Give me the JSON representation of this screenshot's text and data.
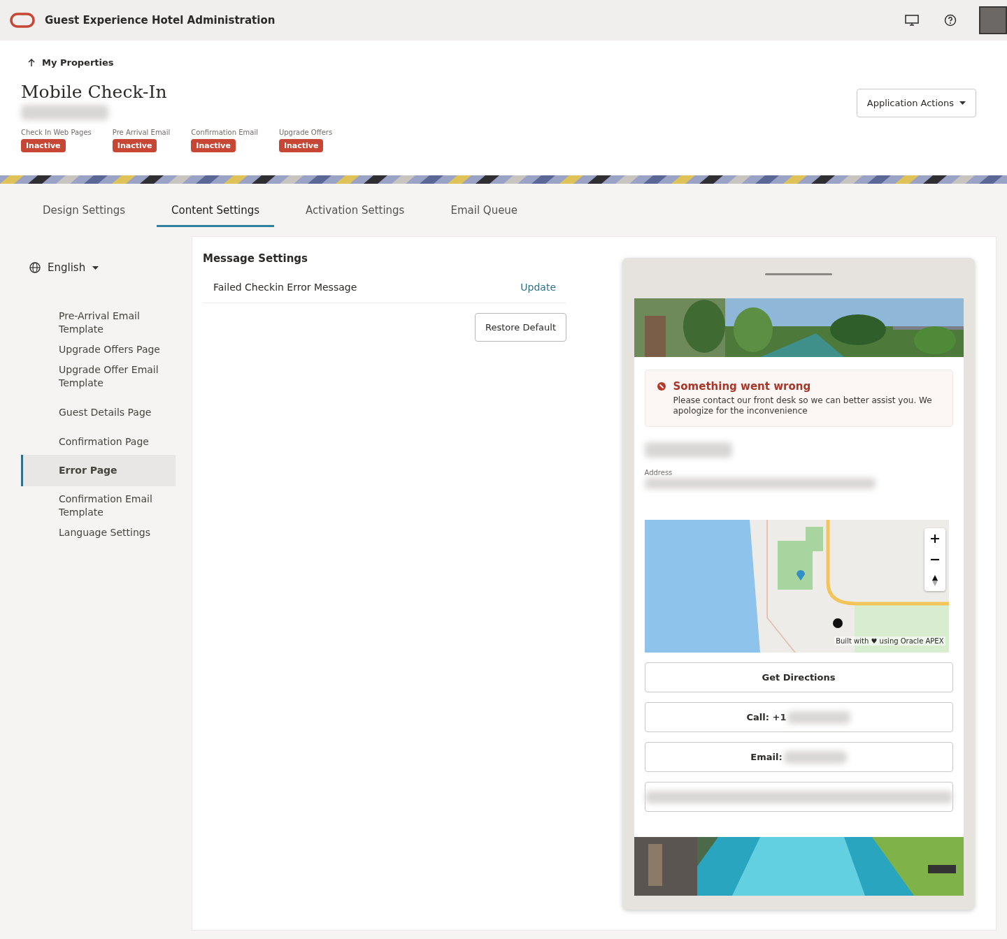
{
  "app": {
    "title": "Guest Experience Hotel Administration"
  },
  "breadcrumb": "My Properties",
  "page_title": "Mobile Check-In",
  "statuses": [
    {
      "label": "Check In Web Pages",
      "badge": "Inactive"
    },
    {
      "label": "Pre Arrival Email",
      "badge": "Inactive"
    },
    {
      "label": "Confirmation Email",
      "badge": "Inactive"
    },
    {
      "label": "Upgrade Offers",
      "badge": "Inactive"
    }
  ],
  "actions_button": "Application Actions",
  "tabs": [
    {
      "label": "Design Settings",
      "selected": false
    },
    {
      "label": "Content Settings",
      "selected": true
    },
    {
      "label": "Activation Settings",
      "selected": false
    },
    {
      "label": "Email Queue",
      "selected": false
    }
  ],
  "language": "English",
  "nav": [
    {
      "label": "Pre-Arrival Email Template",
      "selected": false
    },
    {
      "label": "Upgrade Offers Page",
      "selected": false
    },
    {
      "label": "Upgrade Offer Email Template",
      "selected": false
    },
    {
      "label": "Guest Details Page",
      "selected": false
    },
    {
      "label": "Confirmation Page",
      "selected": false
    },
    {
      "label": "Error Page",
      "selected": true
    },
    {
      "label": "Confirmation Email Template",
      "selected": false
    },
    {
      "label": "Language Settings",
      "selected": false
    }
  ],
  "message_settings": {
    "heading": "Message Settings",
    "rows": [
      {
        "label": "Failed Checkin Error Message",
        "action": "Update"
      }
    ],
    "restore_button": "Restore Default"
  },
  "preview": {
    "alert": {
      "title": "Something went wrong",
      "message": "Please contact our front desk so we can better assist you. We apologize for the inconvenience"
    },
    "address_label": "Address",
    "map": {
      "attribution": "Built with ♥ using Oracle APEX"
    },
    "buttons": [
      "Get Directions",
      "Call: +1",
      "Email:"
    ]
  }
}
